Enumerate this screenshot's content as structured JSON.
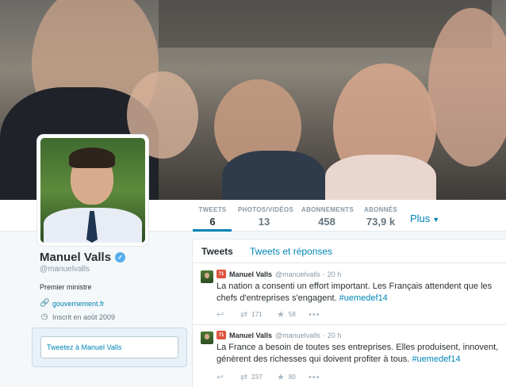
{
  "profile": {
    "name": "Manuel Valls",
    "handle": "@manuelvalls",
    "bio": "Premier ministre",
    "website": "gouvernement.fr",
    "joined": "Inscrit en août 2009",
    "tweet_to_placeholder": "Tweetez à Manuel Valls"
  },
  "stats": [
    {
      "label": "TWEETS",
      "value": "6"
    },
    {
      "label": "PHOTOS/VIDÉOS",
      "value": "13"
    },
    {
      "label": "ABONNEMENTS",
      "value": "458"
    },
    {
      "label": "ABONNÉS",
      "value": "73,9 k"
    }
  ],
  "more_label": "Plus",
  "timeline": {
    "tabs": [
      "Tweets",
      "Tweets et réponses"
    ],
    "tweets": [
      {
        "rank": "71",
        "name": "Manuel Valls",
        "handle": "@manuelvalls",
        "time": "20 h",
        "text": "La nation a consenti un effort important. Les Français attendent que les chefs d'entreprises s'engagent.",
        "hashtag": "#uemedef14",
        "retweets": "171",
        "favorites": "58"
      },
      {
        "rank": "71",
        "name": "Manuel Valls",
        "handle": "@manuelvalls",
        "time": "20 h",
        "text": "La France a besoin de toutes ses entreprises. Elles produisent, innovent, génèrent des richesses qui doivent profiter à tous.",
        "hashtag": "#uemedef14",
        "retweets": "237",
        "favorites": "80"
      }
    ]
  },
  "colors": {
    "accent": "#0084b4",
    "verified": "#55acee",
    "background": "#f5f8fa"
  }
}
